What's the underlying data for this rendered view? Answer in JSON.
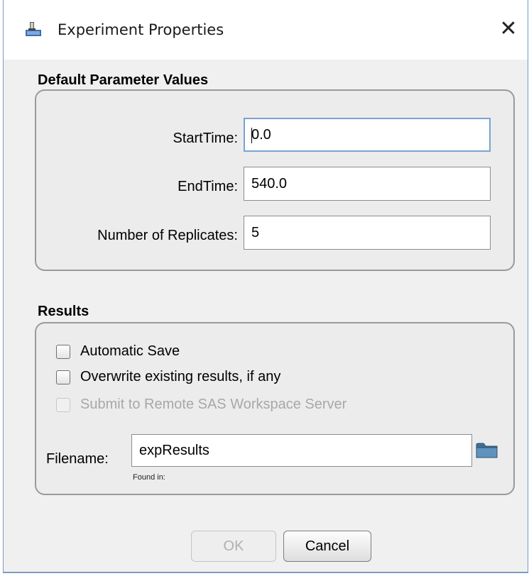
{
  "window": {
    "title": "Experiment Properties",
    "close_label": "✕"
  },
  "defaults": {
    "section_title": "Default Parameter Values",
    "start_time": {
      "label": "StartTime:",
      "value": "0.0"
    },
    "end_time": {
      "label": "EndTime:",
      "value": "540.0"
    },
    "replicates": {
      "label": "Number of Replicates:",
      "value": "5"
    }
  },
  "results": {
    "section_title": "Results",
    "automatic_save": {
      "label": "Automatic Save",
      "checked": false
    },
    "overwrite": {
      "label": "Overwrite existing results, if any",
      "checked": false
    },
    "submit_remote": {
      "label": "Submit to Remote SAS Workspace Server",
      "checked": false,
      "disabled": true
    },
    "filename": {
      "label": "Filename:",
      "value": "expResults",
      "found_in": "Found in:"
    }
  },
  "buttons": {
    "ok": "OK",
    "cancel": "Cancel"
  }
}
